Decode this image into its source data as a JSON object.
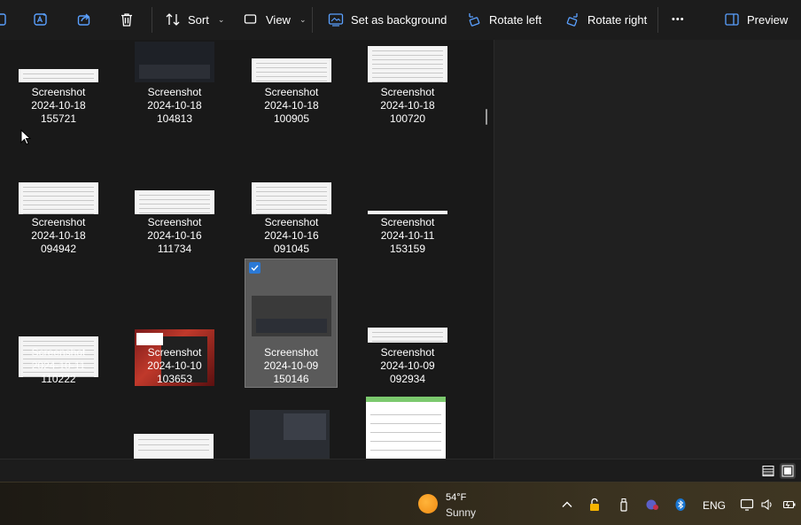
{
  "toolbar": {
    "sort_label": "Sort",
    "view_label": "View",
    "set_background_label": "Set as background",
    "rotate_left_label": "Rotate left",
    "rotate_right_label": "Rotate right",
    "more_label": "•••",
    "preview_label": "Preview",
    "icons": [
      "ai-edit-icon",
      "share-icon",
      "delete-icon",
      "sort-icon",
      "view-icon",
      "set-background-icon",
      "rotate-left-icon",
      "rotate-right-icon",
      "more-icon",
      "preview-icon"
    ]
  },
  "files": [
    {
      "name": "Screenshot",
      "date": "2024-10-18",
      "time": "155721",
      "thumb": "light"
    },
    {
      "name": "Screenshot",
      "date": "2024-10-18",
      "time": "104813",
      "thumb": "dark"
    },
    {
      "name": "Screenshot",
      "date": "2024-10-18",
      "time": "100905",
      "thumb": "light"
    },
    {
      "name": "Screenshot",
      "date": "2024-10-18",
      "time": "100720",
      "thumb": "light"
    },
    {
      "name": "Screenshot",
      "date": "2024-10-18",
      "time": "094942",
      "thumb": "light"
    },
    {
      "name": "Screenshot",
      "date": "2024-10-16",
      "time": "111734",
      "thumb": "light"
    },
    {
      "name": "Screenshot",
      "date": "2024-10-16",
      "time": "091045",
      "thumb": "light"
    },
    {
      "name": "Screenshot",
      "date": "2024-10-11",
      "time": "153159",
      "thumb": "light"
    },
    {
      "name": "Screenshot",
      "date": "2024-10-11",
      "time": "110222",
      "thumb": "light"
    },
    {
      "name": "Screenshot",
      "date": "2024-10-10",
      "time": "103653",
      "thumb": "red"
    },
    {
      "name": "Screenshot",
      "date": "2024-10-09",
      "time": "150146",
      "thumb": "dark",
      "selected": true
    },
    {
      "name": "Screenshot",
      "date": "2024-10-09",
      "time": "092934",
      "thumb": "light"
    }
  ],
  "statusbar": {
    "view_modes": [
      "details-view-icon",
      "large-icons-view-icon"
    ],
    "active_view": "large-icons-view-icon"
  },
  "taskbar": {
    "temperature": "54°F",
    "condition": "Sunny",
    "language": "ENG",
    "tray_icons": [
      "chevron-up-icon",
      "vpn-lock-icon",
      "usb-drive-icon",
      "teams-icon",
      "bluetooth-icon",
      "display-icon",
      "volume-icon",
      "battery-icon"
    ]
  },
  "colors": {
    "accent": "#2b79d6",
    "background": "#191919",
    "selected_tile": "#5a5a5a"
  }
}
